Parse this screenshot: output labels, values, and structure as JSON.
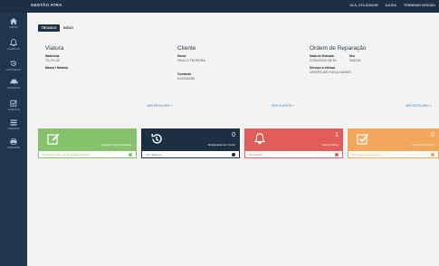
{
  "app": {
    "title": "GESTÃO ATRA"
  },
  "topbar": {
    "items": [
      "OLÁ, UTILIZADOR",
      "AJUDA",
      "TERMINAR SESSÃO"
    ]
  },
  "sidebar": {
    "items": [
      {
        "label": "INÍCIO",
        "icon": "home-icon"
      },
      {
        "label": "ALERTAS",
        "icon": "bell-icon"
      },
      {
        "label": "HISTÓRICO",
        "icon": "history-icon"
      },
      {
        "label": "VIATURAS",
        "icon": "car-icon"
      },
      {
        "label": "TAREFAS",
        "icon": "checkbox-icon"
      },
      {
        "label": "ORDENS",
        "icon": "list-icon"
      },
      {
        "label": "IMPRIMIR",
        "icon": "print-icon"
      }
    ]
  },
  "breadcrumb": {
    "button": "TÉCNICO",
    "current": "INÍCIO"
  },
  "viatura": {
    "title": "Viatura",
    "matricula_label": "Matrícula",
    "matricula": "73-FG-02",
    "marca_label": "Marca / Modelo",
    "marca": ""
  },
  "cliente": {
    "title": "Cliente",
    "nome_label": "Nome",
    "nome": "PAULO TEIXEIRA",
    "contacto_label": "Contacto",
    "contacto": "914334455"
  },
  "ordem": {
    "title": "Ordem de Reparação",
    "data_label": "Data de Entrada",
    "data": "27/05/2016 08:30",
    "nro_label": "Nro",
    "nro": "345231",
    "servico_label": "Serviço a efetuar",
    "servico": "VERIFICAR FUGA GASES"
  },
  "links": {
    "viatura": "VER DETALHES »",
    "cliente": "VER CLIENTE »",
    "ordem": "VER DETALHES »"
  },
  "cards": [
    {
      "count": "",
      "desc": "Registar Nova Reparação",
      "footer": "Registar Ordem de Reparação Manual",
      "color": "#86c26b"
    },
    {
      "count": "0",
      "desc": "Reparações em Curso",
      "footer": "Ver Histórico",
      "color": "#1d2f43"
    },
    {
      "count": "1",
      "desc": "Alertas Ativos",
      "footer": "Ver Alertas",
      "color": "#e25c59"
    },
    {
      "count": "0",
      "desc": "Tarefas Pendentes",
      "footer": "Ver Tarefas Pendentes",
      "color": "#f3a75a"
    }
  ]
}
